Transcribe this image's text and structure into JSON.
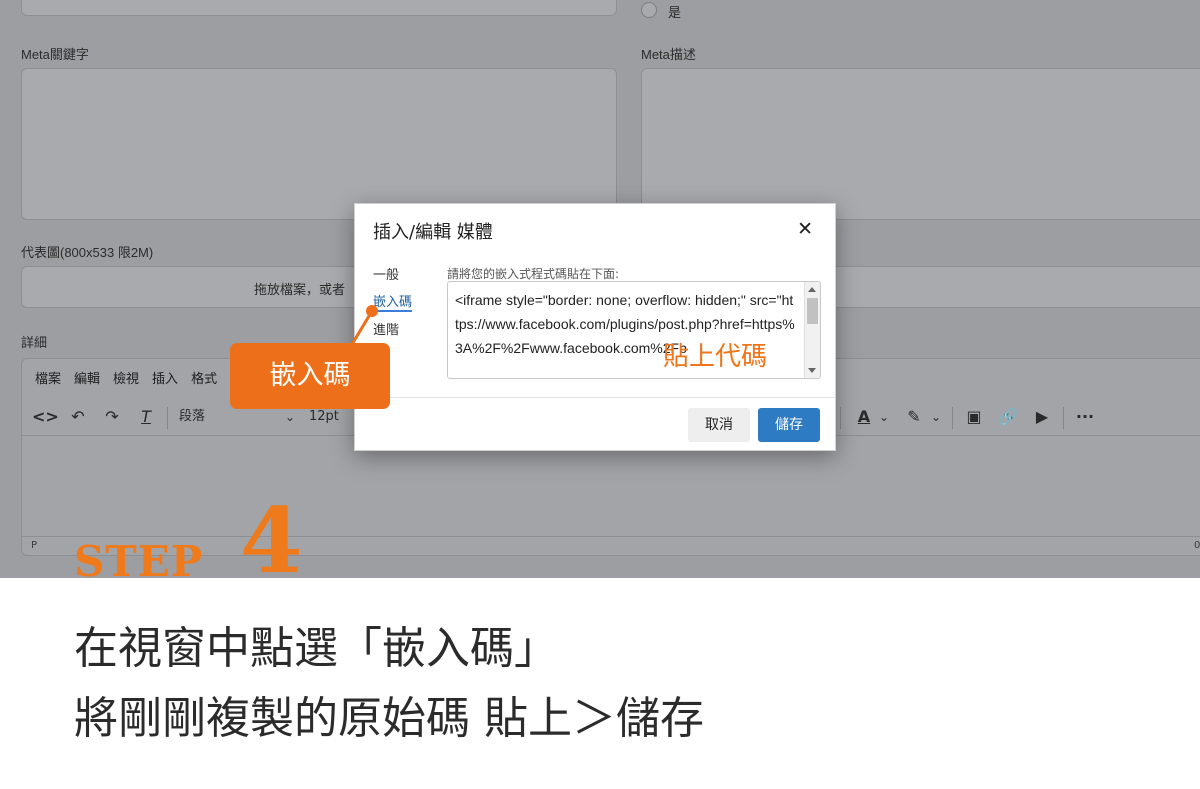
{
  "form": {
    "radio_yes_label": "是",
    "meta_keywords_label": "Meta關鍵字",
    "meta_description_label": "Meta描述",
    "cover_image_label": "代表圖(800x533 限2M)",
    "upload_hint": "拖放檔案，或者",
    "detail_label": "詳細"
  },
  "editor": {
    "menu": [
      "檔案",
      "編輯",
      "檢視",
      "插入",
      "格式"
    ],
    "block_format": "段落",
    "font_size": "12pt",
    "status_path": "P",
    "word_count": "0"
  },
  "dialog": {
    "title": "插入/編輯 媒體",
    "tabs": [
      "一般",
      "嵌入碼",
      "進階"
    ],
    "active_tab": 1,
    "hint": "請將您的嵌入式程式碼貼在下面:",
    "code": "<iframe style=\"border: none; overflow: hidden;\" src=\"https://www.facebook.com/plugins/post.php?href=https%3A%2F%2Fwww.facebook.com%2Fp",
    "cancel_label": "取消",
    "save_label": "儲存"
  },
  "annotations": {
    "callout": "嵌入碼",
    "paste_note": "貼上代碼",
    "accent_color": "#ee6f19"
  },
  "step": {
    "word": "STEP",
    "number": "4",
    "line1": "在視窗中點選「嵌入碼」",
    "line2": "將剛剛複製的原始碼 貼上＞儲存"
  }
}
